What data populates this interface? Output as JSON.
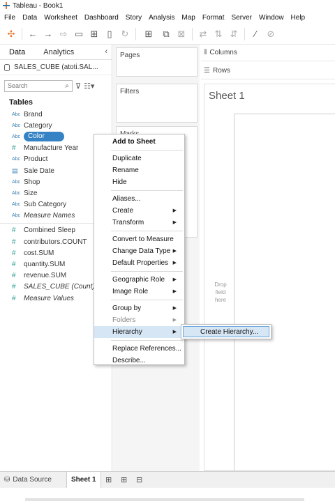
{
  "window": {
    "title": "Tableau - Book1"
  },
  "menu": [
    "File",
    "Data",
    "Worksheet",
    "Dashboard",
    "Story",
    "Analysis",
    "Map",
    "Format",
    "Server",
    "Window",
    "Help"
  ],
  "data_pane": {
    "tabs": [
      "Data",
      "Analytics"
    ],
    "datasource": "SALES_CUBE (atoti.SAL...",
    "search_placeholder": "Search",
    "tables_label": "Tables",
    "dimensions": [
      {
        "icon": "Abc",
        "label": "Brand"
      },
      {
        "icon": "Abc",
        "label": "Category"
      },
      {
        "icon": "Abc",
        "label": "Color"
      },
      {
        "icon": "#",
        "label": "Manufacture Year"
      },
      {
        "icon": "Abc",
        "label": "Product"
      },
      {
        "icon": "date",
        "label": "Sale Date"
      },
      {
        "icon": "Abc",
        "label": "Shop"
      },
      {
        "icon": "Abc",
        "label": "Size"
      },
      {
        "icon": "Abc",
        "label": "Sub Category"
      },
      {
        "icon": "Abc",
        "label": "Measure Names"
      }
    ],
    "measures": [
      {
        "icon": "#",
        "label": "Combined Sleep"
      },
      {
        "icon": "#",
        "label": "contributors.COUNT"
      },
      {
        "icon": "#",
        "label": "cost.SUM"
      },
      {
        "icon": "#",
        "label": "quantity.SUM"
      },
      {
        "icon": "#",
        "label": "revenue.SUM"
      },
      {
        "icon": "#",
        "label": "SALES_CUBE (Count)"
      },
      {
        "icon": "#",
        "label": "Measure Values"
      }
    ]
  },
  "shelves": {
    "pages": "Pages",
    "filters": "Filters",
    "marks": "Marks",
    "columns": "Columns",
    "rows": "Rows"
  },
  "sheet": {
    "title": "Sheet 1",
    "drop_hint": "Drop field here"
  },
  "bottom": {
    "datasource_tab": "Data Source",
    "sheet_tab": "Sheet 1"
  },
  "context_menu": {
    "items": [
      {
        "label": "Add to Sheet",
        "bold": true
      },
      {
        "sep": true
      },
      {
        "label": "Duplicate"
      },
      {
        "label": "Rename"
      },
      {
        "label": "Hide"
      },
      {
        "sep": true
      },
      {
        "label": "Aliases..."
      },
      {
        "label": "Create",
        "arrow": true
      },
      {
        "label": "Transform",
        "arrow": true
      },
      {
        "sep": true
      },
      {
        "label": "Convert to Measure"
      },
      {
        "label": "Change Data Type",
        "arrow": true
      },
      {
        "label": "Default Properties",
        "arrow": true
      },
      {
        "sep": true
      },
      {
        "label": "Geographic Role",
        "arrow": true
      },
      {
        "label": "Image Role",
        "arrow": true
      },
      {
        "sep": true
      },
      {
        "label": "Group by",
        "arrow": true
      },
      {
        "label": "Folders",
        "arrow": true,
        "disabled": true
      },
      {
        "label": "Hierarchy",
        "arrow": true,
        "highlight": true
      },
      {
        "sep": true
      },
      {
        "label": "Replace References..."
      },
      {
        "label": "Describe..."
      }
    ],
    "submenu_item": "Create Hierarchy..."
  },
  "colors": {
    "selection": "#3582c4",
    "menu_highlight": "#d7e6f5"
  }
}
